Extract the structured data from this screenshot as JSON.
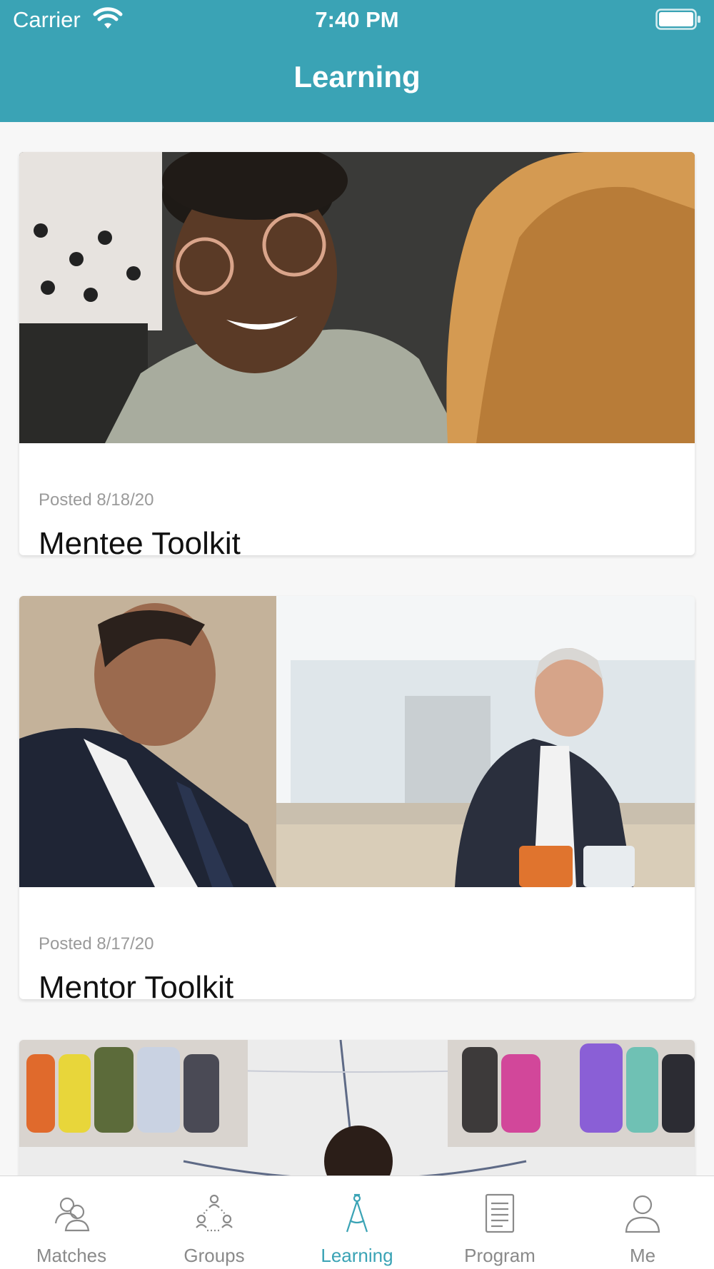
{
  "status_bar": {
    "carrier": "Carrier",
    "time": "7:40 PM"
  },
  "header": {
    "title": "Learning"
  },
  "colors": {
    "accent": "#3aa3b5",
    "inactive": "#8a8a8a"
  },
  "cards": [
    {
      "date": "Posted 8/18/20",
      "title": "Mentee Toolkit",
      "image": "photo-mentee-conversation"
    },
    {
      "date": "Posted 8/17/20",
      "title": "Mentor Toolkit",
      "image": "photo-mentors-talking"
    },
    {
      "date": "",
      "title": "",
      "image": "photo-audience-gym"
    }
  ],
  "tabs": [
    {
      "label": "Matches",
      "icon": "matches-icon",
      "active": false
    },
    {
      "label": "Groups",
      "icon": "groups-icon",
      "active": false
    },
    {
      "label": "Learning",
      "icon": "compass-icon",
      "active": true
    },
    {
      "label": "Program",
      "icon": "document-icon",
      "active": false
    },
    {
      "label": "Me",
      "icon": "person-icon",
      "active": false
    }
  ]
}
